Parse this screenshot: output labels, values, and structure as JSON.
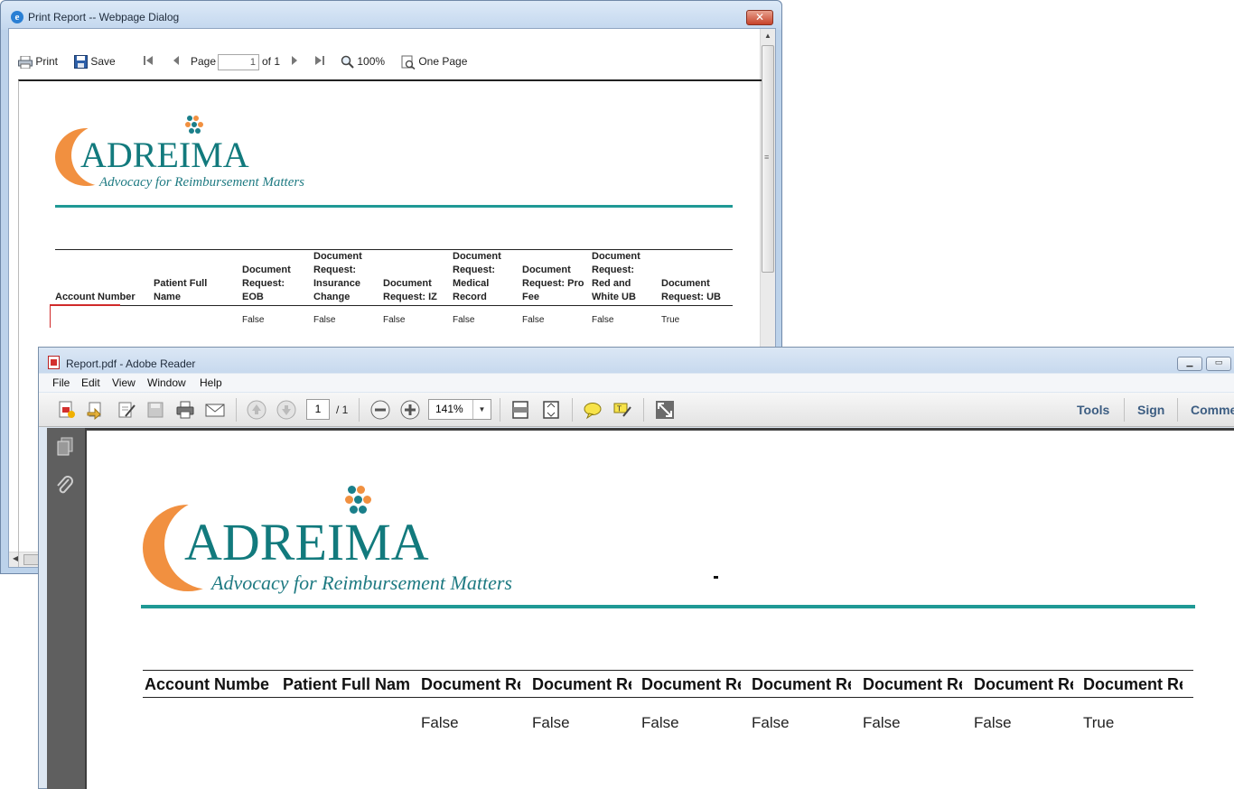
{
  "dialog": {
    "title": "Print Report -- Webpage Dialog",
    "close_label": "✕",
    "toolbar": {
      "print": "Print",
      "save": "Save",
      "page_label": "Page",
      "page_value": "1",
      "page_of": "of 1",
      "zoom": "100%",
      "one_page": "One Page"
    }
  },
  "logo": {
    "brand": "ADREIMA",
    "tagline": "Advocacy for Reimbursement Matters",
    "colors": {
      "orange": "#f19040",
      "teal": "#127a7d",
      "rule": "#1f9995"
    }
  },
  "report_small": {
    "headers": [
      "Account Number",
      "Patient Full Name",
      "Document Request: EOB",
      "Document Request: Insurance Change",
      "Document Request: IZ",
      "Document Request: Medical Record",
      "Document Request: Pro Fee",
      "Document Request: Red and White UB",
      "Document Request: UB"
    ],
    "row": [
      "",
      "",
      "False",
      "False",
      "False",
      "False",
      "False",
      "False",
      "True"
    ]
  },
  "reader": {
    "title": "Report.pdf - Adobe Reader",
    "menu": [
      "File",
      "Edit",
      "View",
      "Window",
      "Help"
    ],
    "page_value": "1",
    "page_of": "/ 1",
    "zoom": "141%",
    "right_tools": [
      "Tools",
      "Sign",
      "Comme"
    ]
  },
  "report_big": {
    "headers": [
      "Account Numbe",
      "Patient Full Nam",
      "Document Re",
      "Document Re",
      "Document Re",
      "Document Re",
      "Document Re",
      "Document Re",
      "Document Re"
    ],
    "row": [
      "",
      "",
      "False",
      "False",
      "False",
      "False",
      "False",
      "False",
      "True"
    ]
  }
}
